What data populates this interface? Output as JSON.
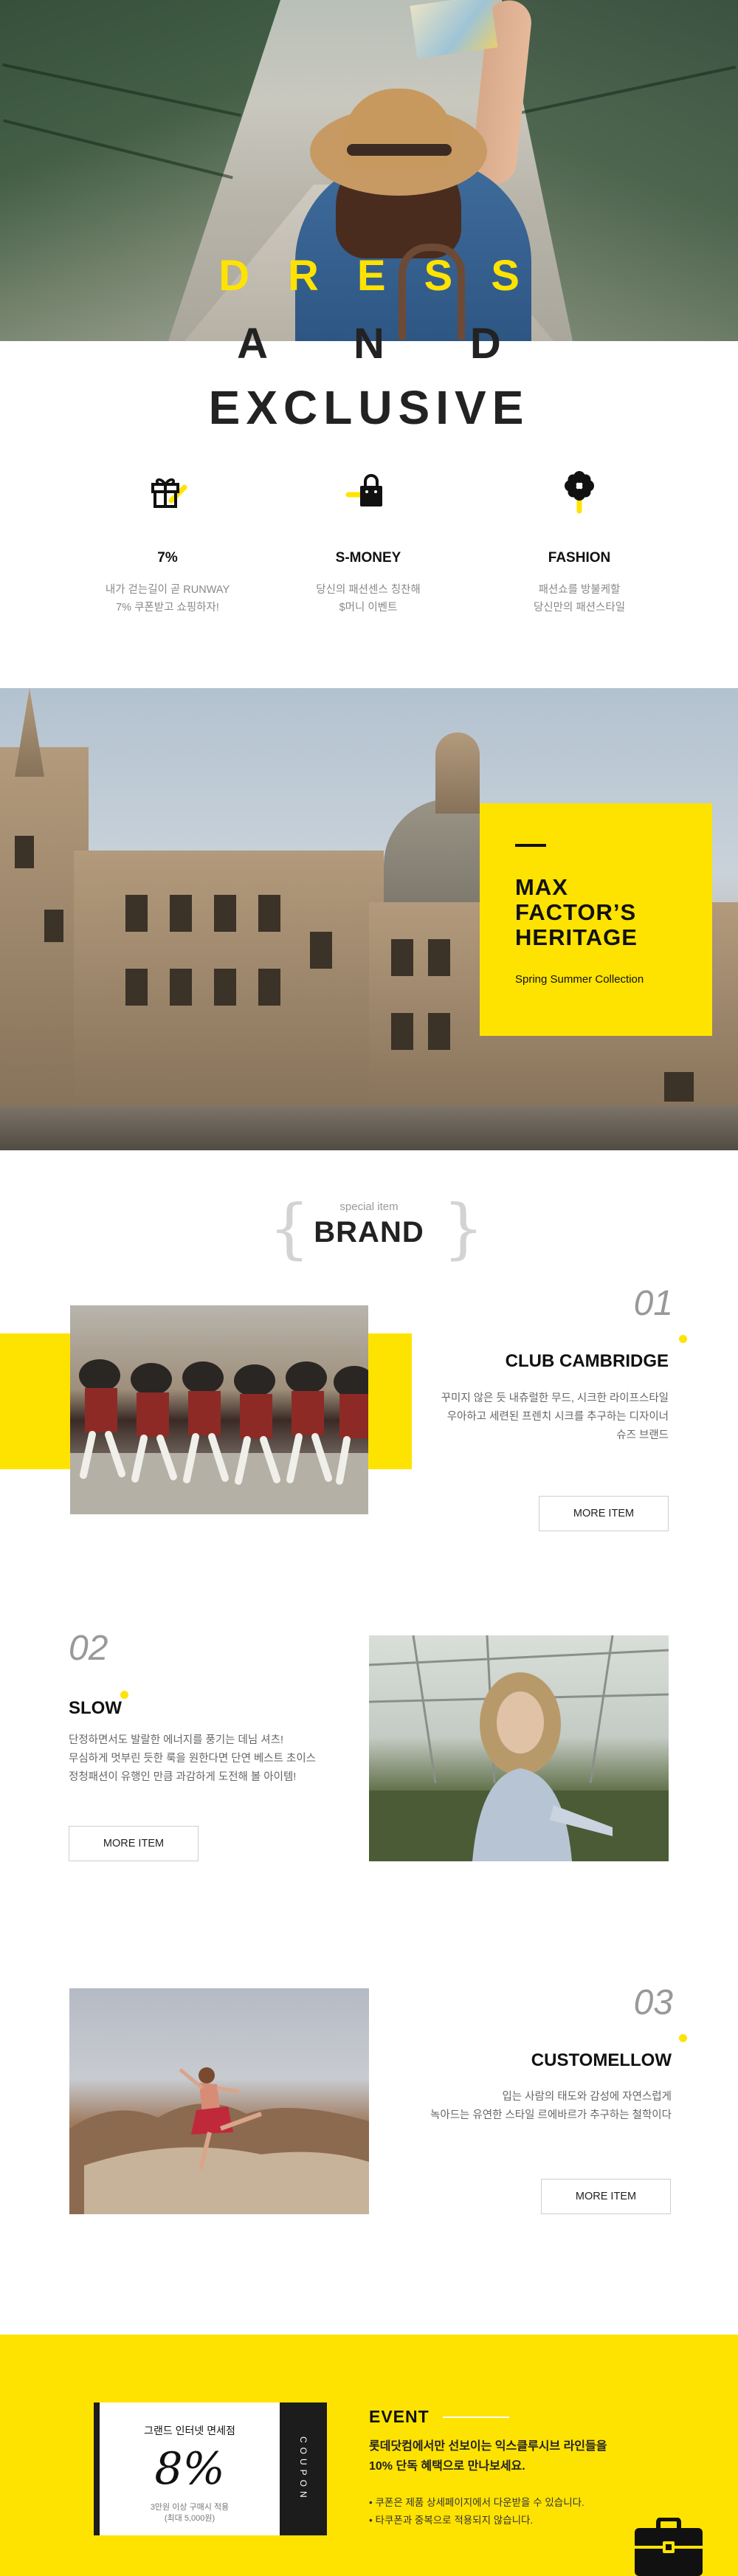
{
  "hero": {
    "line1": "DRESS",
    "line2": "AND",
    "line3": "EXCLUSIVE"
  },
  "features": [
    {
      "icon": "gift-icon",
      "title": "7%",
      "desc": [
        "내가 걷는길이 곧 RUNWAY",
        "7% 쿠폰받고 쇼핑하자!"
      ]
    },
    {
      "icon": "shopping-bag-icon",
      "title": "S-MONEY",
      "desc": [
        "당신의 패션센스 칭찬해",
        "$머니 이벤트"
      ]
    },
    {
      "icon": "flower-icon",
      "title": "FASHION",
      "desc": [
        "패션쇼를 방불케할",
        "당신만의 패션스타일"
      ]
    }
  ],
  "heritage": {
    "title_lines": [
      "MAX",
      "FACTOR’S",
      "HERITAGE"
    ],
    "subtitle": "Spring Summer Collection"
  },
  "brand": {
    "small": "special item",
    "title": "BRAND"
  },
  "items": [
    {
      "number": "01",
      "title": "CLUB CAMBRIDGE",
      "desc": [
        "꾸미지 않은 듯 내츄럴한 무드, 시크한 라이프스타일",
        "우아하고 세련된 프렌치 시크를 추구하는 디자이너",
        "슈즈 브랜드"
      ],
      "button": "MORE ITEM"
    },
    {
      "number": "02",
      "title": "SLOW",
      "desc": [
        "단정하면서도 발랄한 에너지를 풍기는 데님 셔츠!",
        "무심하게 멋부린 듯한 룩을 원한다면 단연 베스트 초이스",
        "정청패션이 유행인 만큼 과감하게 도전해 볼 아이템!"
      ],
      "button": "MORE ITEM"
    },
    {
      "number": "03",
      "title": "CUSTOMELLOW",
      "desc": [
        "입는 사람의 태도와 감성에 자연스럽게",
        "녹아드는 유연한 스타일 르에바르가 추구하는 철학이다"
      ],
      "button": "MORE ITEM"
    }
  ],
  "event": {
    "coupon_title": "그랜드 인터넷 면세점",
    "coupon_percent": "8%",
    "coupon_note": [
      "3만원 이상 구매시 적용",
      "(최대 5,000원)"
    ],
    "coupon_side": "COUPON",
    "title": "EVENT",
    "main": [
      "롯데닷컴에서만 선보이는 익스클루시브 라인들을",
      "10% 단독 혜택으로 만나보세요."
    ],
    "notes": [
      "쿠폰은 제품 상세페이지에서 다운받을 수 있습니다.",
      "타쿠폰과 중복으로 적용되지 않습니다."
    ]
  },
  "colors": {
    "accent": "#ffe300",
    "dark": "#111111",
    "muted": "#888888"
  }
}
